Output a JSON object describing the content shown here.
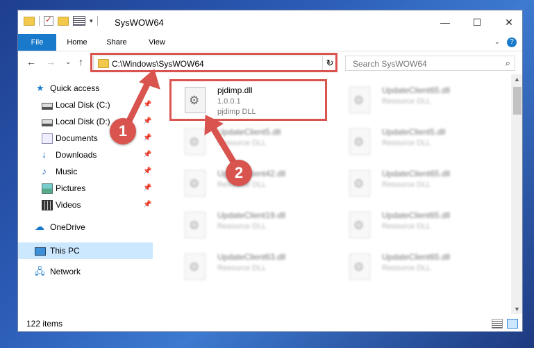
{
  "window": {
    "title": "SysWOW64",
    "minimize": "—",
    "maximize": "☐",
    "close": "✕"
  },
  "ribbon": {
    "tabs": [
      "File",
      "Home",
      "Share",
      "View"
    ],
    "collapse": "⌄",
    "help": "?"
  },
  "nav": {
    "back": "←",
    "forward": "→",
    "recent": "⌄",
    "up": "↑",
    "address": "C:\\Windows\\SysWOW64",
    "address_dropdown": "⌄",
    "refresh": "↻",
    "search_placeholder": "Search SysWOW64",
    "search_icon": "⌕"
  },
  "sidebar": {
    "items": [
      {
        "label": "Quick access",
        "icon": "star-icon",
        "pinned": false
      },
      {
        "label": "Local Disk (C:)",
        "icon": "drive-icon",
        "pinned": true
      },
      {
        "label": "Local Disk (D:)",
        "icon": "drive-icon",
        "pinned": true
      },
      {
        "label": "Documents",
        "icon": "documents-icon",
        "pinned": true
      },
      {
        "label": "Downloads",
        "icon": "download-icon",
        "pinned": true
      },
      {
        "label": "Music",
        "icon": "music-icon",
        "pinned": true
      },
      {
        "label": "Pictures",
        "icon": "pictures-icon",
        "pinned": true
      },
      {
        "label": "Videos",
        "icon": "videos-icon",
        "pinned": true
      },
      {
        "label": "OneDrive",
        "icon": "onedrive-icon",
        "pinned": false
      },
      {
        "label": "This PC",
        "icon": "pc-icon",
        "pinned": false,
        "selected": true
      },
      {
        "label": "Network",
        "icon": "network-icon",
        "pinned": false
      }
    ],
    "pin_glyph": "📌"
  },
  "files": {
    "highlighted": {
      "name": "pjdimp.dll",
      "version": "1.0.0.1",
      "type": "pjdimp DLL"
    },
    "left_column": [
      {
        "name": "UpdateClient5.dll",
        "type": "Resource DLL"
      },
      {
        "name": "UpdateClient42.dll",
        "type": "Resource DLL"
      },
      {
        "name": "UpdateClient19.dll",
        "type": "Resource DLL"
      },
      {
        "name": "UpdateClient63.dll",
        "type": "Resource DLL"
      }
    ],
    "right_column": [
      {
        "name": "UpdateClient65.dll",
        "type": "Resource DLL"
      },
      {
        "name": "UpdateClient5.dll",
        "type": "Resource DLL"
      },
      {
        "name": "UpdateClient65.dll",
        "type": "Resource DLL"
      },
      {
        "name": "UpdateClient65.dll",
        "type": "Resource DLL"
      },
      {
        "name": "UpdateClient65.dll",
        "type": "Resource DLL"
      }
    ]
  },
  "status": {
    "count": "122 items"
  },
  "annotations": {
    "badge1": "1",
    "badge2": "2",
    "color": "#d9534f"
  }
}
